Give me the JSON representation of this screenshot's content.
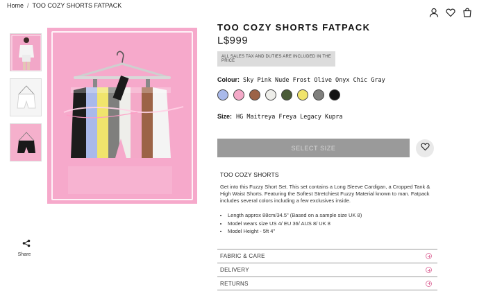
{
  "breadcrumb": {
    "home": "Home",
    "separator": "/",
    "current": "TOO COZY SHORTS FATPACK"
  },
  "header": {
    "icons": [
      "user-icon",
      "heart-icon",
      "bag-icon"
    ]
  },
  "gallery": {
    "thumbnails": [
      "outfit-thumbnail",
      "white-shorts-thumbnail",
      "black-shorts-thumbnail"
    ],
    "main_image": "shorts-fatpack-image"
  },
  "share": {
    "label": "Share"
  },
  "product": {
    "title": "TOO COZY SHORTS FATPACK",
    "price": "L$999",
    "tax_note": "ALL SALES TAX AND DUTIES ARE INCLUDED IN THE PRICE",
    "colour_label": "Colour:",
    "colour_options": "Sky Pink Nude Frost Olive Onyx Chic Gray",
    "swatches": [
      {
        "name": "Sky",
        "hex": "#a9b9ea"
      },
      {
        "name": "Pink",
        "hex": "#f4a9c8"
      },
      {
        "name": "Nude",
        "hex": "#9c6347"
      },
      {
        "name": "Frost",
        "hex": "#eeeeea"
      },
      {
        "name": "Olive",
        "hex": "#4a5b38"
      },
      {
        "name": "Chic",
        "hex": "#f0e46c"
      },
      {
        "name": "Gray",
        "hex": "#7f7f7d"
      },
      {
        "name": "Onyx",
        "hex": "#141414"
      }
    ],
    "size_label": "Size:",
    "size_options": "HG Maitreya Freya Legacy Kupra",
    "select_size_button": "SELECT SIZE"
  },
  "description": {
    "heading": "TOO COZY SHORTS",
    "body": "Get into this Fuzzy Short Set. This set contains a Long Sleeve Cardigan, a Cropped Tank & High Waist Shorts. Featuring the Softest Stretchiest Fuzzy Material known to man. Fatpack includes several colors including a few exclusives inside.",
    "bullets": [
      "Length approx 88cm/34.5\" (Based on a sample size UK 8)",
      "Model wears size US 4/ EU 36/ AUS 8/ UK 8",
      "Model Height - 5ft 4\""
    ]
  },
  "accordion": [
    "FABRIC & CARE",
    "DELIVERY",
    "RETURNS"
  ],
  "colors": {
    "accent_pink": "#e07aa4",
    "button_gray": "#9a9a9a"
  }
}
